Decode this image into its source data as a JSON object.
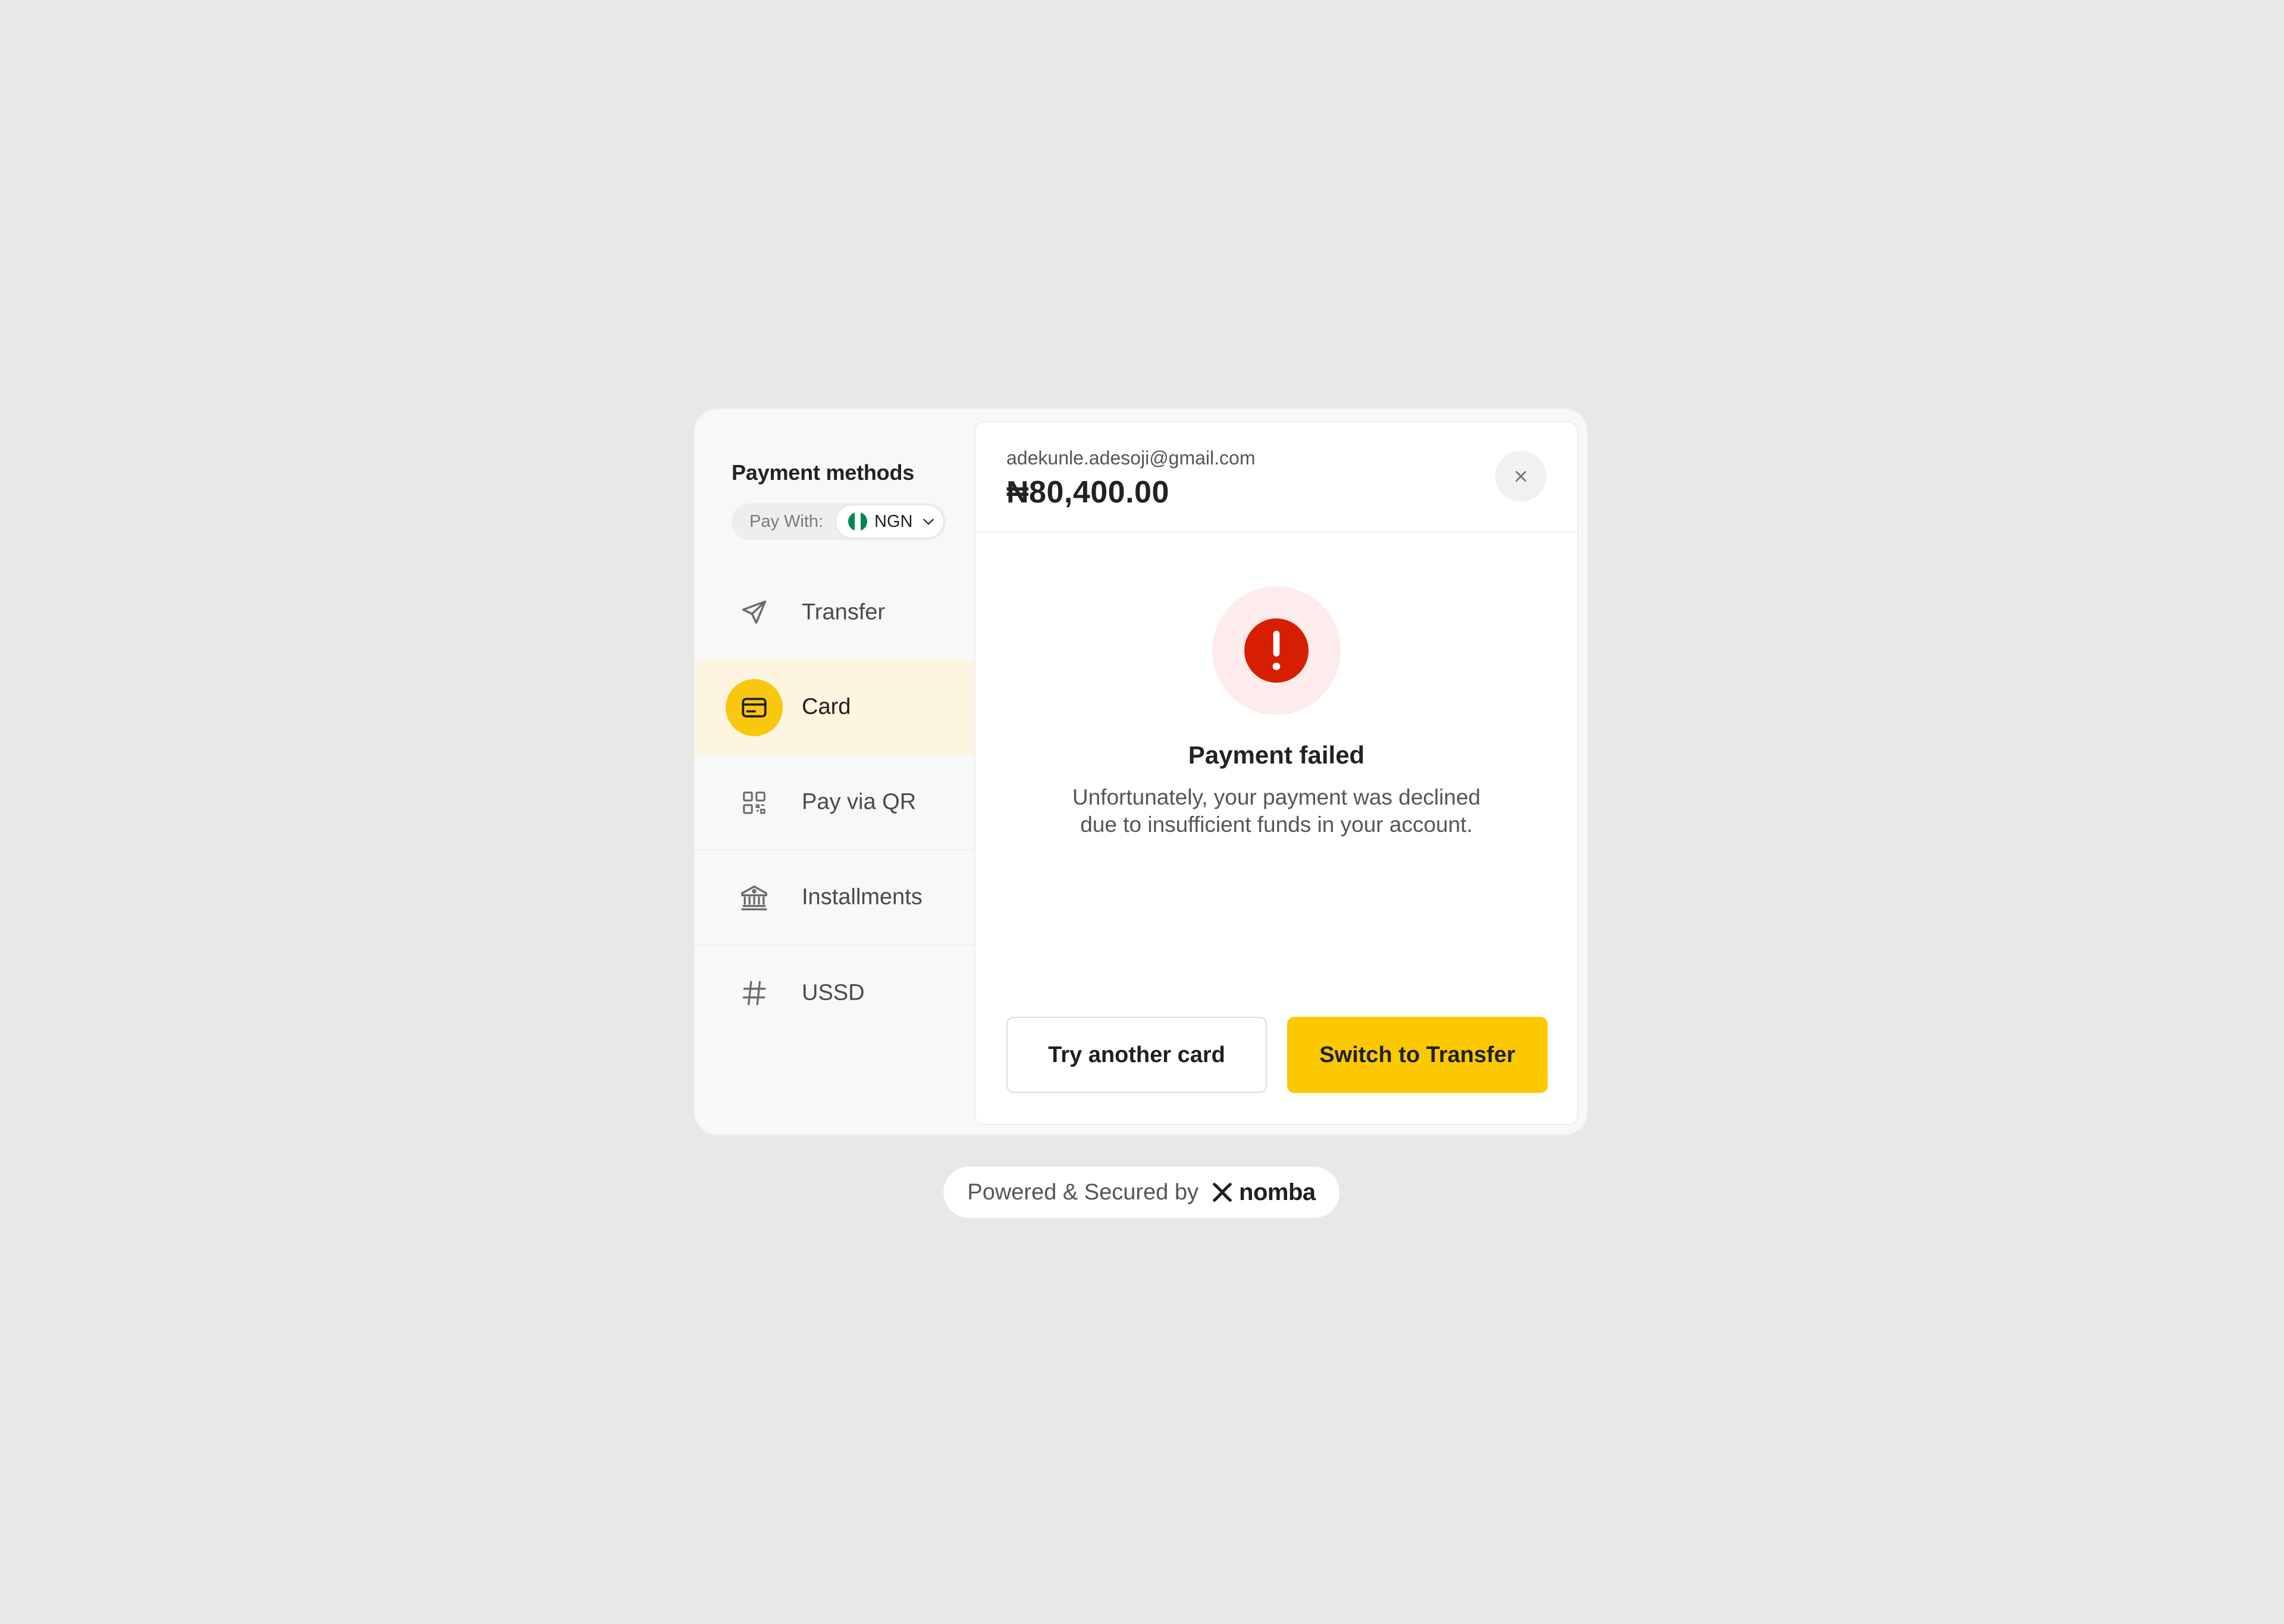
{
  "sidebar": {
    "title": "Payment methods",
    "pay_with_label": "Pay With:",
    "currency": "NGN",
    "flag_colors": [
      "#008751",
      "#ffffff",
      "#008751"
    ],
    "methods": [
      {
        "label": "Transfer",
        "icon": "paper-plane-icon",
        "active": false
      },
      {
        "label": "Card",
        "icon": "credit-card-icon",
        "active": true
      },
      {
        "label": "Pay via QR",
        "icon": "qr-code-icon",
        "active": false
      },
      {
        "label": "Installments",
        "icon": "bank-icon",
        "active": false
      },
      {
        "label": "USSD",
        "icon": "hash-icon",
        "active": false
      }
    ]
  },
  "header": {
    "email": "adekunle.adesoji@gmail.com",
    "amount": "₦80,400.00",
    "close_icon": "close-icon"
  },
  "status": {
    "icon": "exclamation-icon",
    "title": "Payment failed",
    "message_line1": "Unfortunately, your payment was declined",
    "message_line2": "due to insufficient funds in your account.",
    "color": "#d61e00"
  },
  "actions": {
    "secondary_label": "Try another card",
    "primary_label": "Switch to Transfer",
    "accent_color": "#fcc900"
  },
  "footer": {
    "text": "Powered & Secured by",
    "brand": "nomba"
  }
}
